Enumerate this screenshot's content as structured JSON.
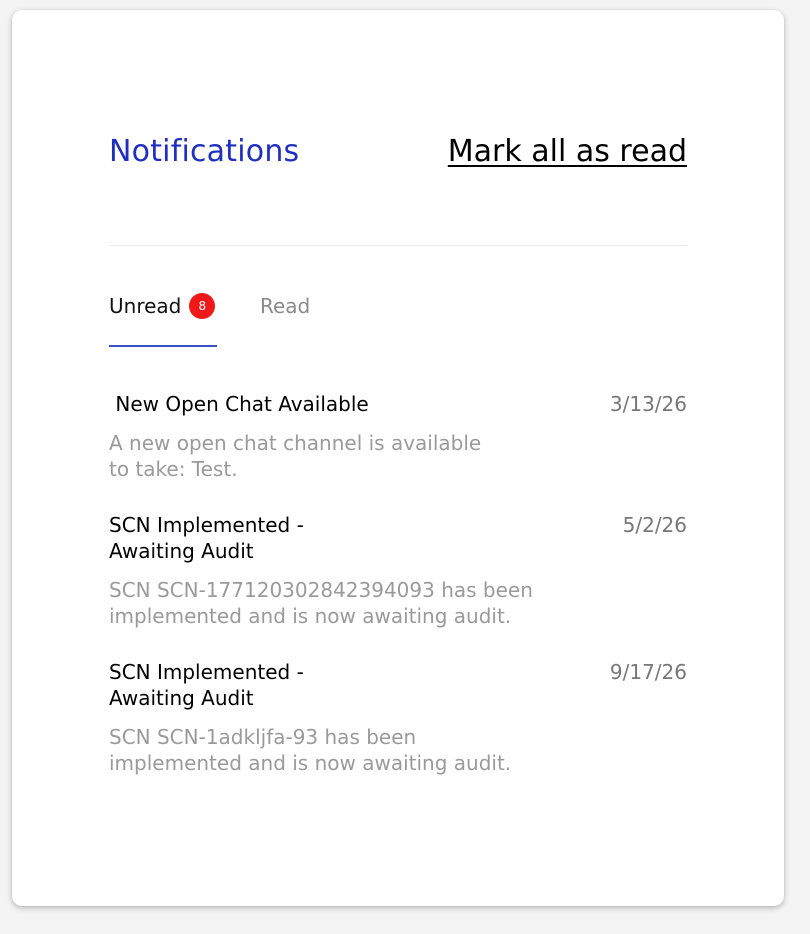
{
  "header": {
    "title": "Notifications",
    "mark_all_label": "Mark all as read"
  },
  "tabs": [
    {
      "label": "Unread",
      "badge": "8",
      "active": true
    },
    {
      "label": "Read",
      "active": false
    }
  ],
  "notifications": [
    {
      "title": " New Open Chat Available",
      "date": "3/13/26",
      "body": "A new open chat channel is available to take: Test."
    },
    {
      "title": "SCN Implemented -\nAwaiting Audit",
      "date": "5/2/26",
      "body": "SCN SCN-1771203028423940​93 has been implemented and is now awaiting audit."
    },
    {
      "title": "SCN Implemented -\nAwaiting Audit",
      "date": "9/17/26",
      "body": "SCN SCN-1adkljfa-93 has been implemented and is now awaiting audit."
    }
  ],
  "colors": {
    "title": "#1f2fbf",
    "badge": "#f01818",
    "tab_underline": "#3b50c4",
    "muted_text": "#9a9a9a"
  }
}
